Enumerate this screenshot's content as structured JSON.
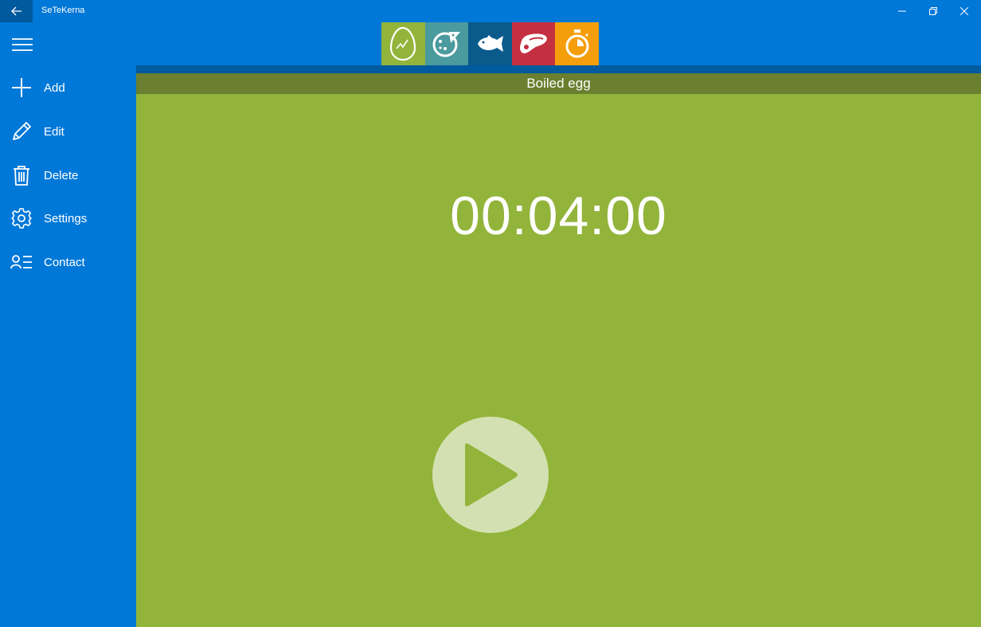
{
  "window": {
    "title": "SeTeKerna"
  },
  "sidebar": {
    "items": [
      {
        "label": "Add",
        "icon": "plus-icon"
      },
      {
        "label": "Edit",
        "icon": "pencil-icon"
      },
      {
        "label": "Delete",
        "icon": "trash-icon"
      },
      {
        "label": "Settings",
        "icon": "gear-icon"
      },
      {
        "label": "Contact",
        "icon": "contact-list-icon"
      }
    ]
  },
  "categories": [
    {
      "name": "egg",
      "icon": "egg-icon",
      "color": "#92b43b"
    },
    {
      "name": "pizza",
      "icon": "pizza-icon",
      "color": "#4a9a9e"
    },
    {
      "name": "fish",
      "icon": "fish-icon",
      "color": "#0b5a8c"
    },
    {
      "name": "meat",
      "icon": "steak-icon",
      "color": "#c4303f"
    },
    {
      "name": "timer",
      "icon": "stopwatch-icon",
      "color": "#f59e0b"
    }
  ],
  "main": {
    "title": "Boiled egg",
    "timer": "00:04:00",
    "background": "#92b43b"
  },
  "colors": {
    "accent": "#0078d7",
    "header_bar": "#6a7f2f"
  }
}
